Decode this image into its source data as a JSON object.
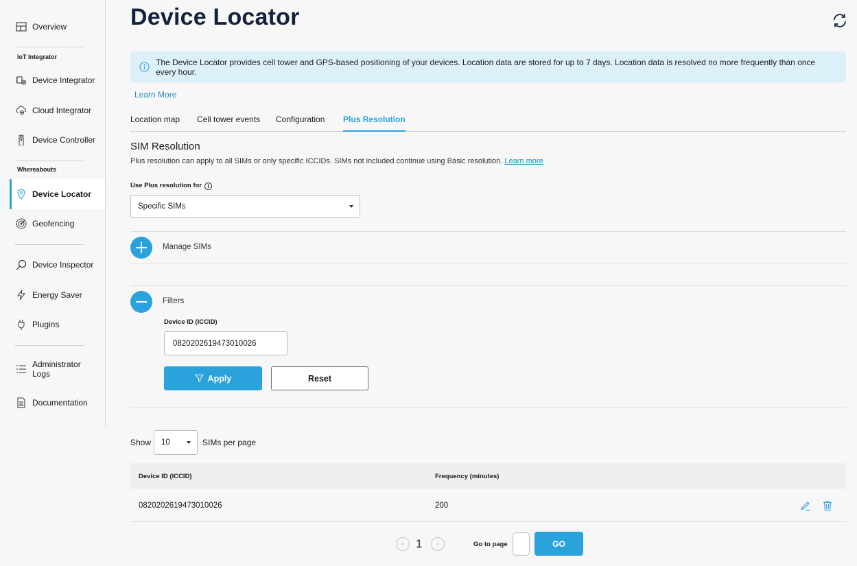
{
  "sidebar": {
    "overview": {
      "label": "Overview",
      "icon": "layout-icon"
    },
    "section_iot": "IoT Integrator",
    "device_integrator": {
      "label": "Device Integrator",
      "icon": "chip-gear-icon"
    },
    "cloud_integrator": {
      "label": "Cloud Integrator",
      "icon": "cloud-gear-icon"
    },
    "device_controller": {
      "label": "Device Controller",
      "icon": "remote-icon"
    },
    "section_whereabouts": "Whereabouts",
    "device_locator": {
      "label": "Device Locator",
      "icon": "location-pin-icon"
    },
    "geofencing": {
      "label": "Geofencing",
      "icon": "radar-icon"
    },
    "device_inspector": {
      "label": "Device Inspector",
      "icon": "magnifier-icon"
    },
    "energy_saver": {
      "label": "Energy Saver",
      "icon": "lightning-icon"
    },
    "plugins": {
      "label": "Plugins",
      "icon": "plug-icon"
    },
    "admin_logs": {
      "line1": "Administrator",
      "line2": "Logs",
      "icon": "list-icon"
    },
    "documentation": {
      "label": "Documentation",
      "icon": "document-icon"
    }
  },
  "header": {
    "title": "Device Locator",
    "refresh_icon": "refresh-icon"
  },
  "info_banner": {
    "text": "The Device Locator provides cell tower and GPS-based positioning of your devices. Location data are stored for up to 7 days. Location data is resolved no more frequently than once every hour.",
    "learn_more": "Learn More"
  },
  "tabs": [
    "Location map",
    "Cell tower events",
    "Configuration",
    "Plus Resolution"
  ],
  "active_tab": "Plus Resolution",
  "sim_resolution": {
    "title": "SIM Resolution",
    "description": "Plus resolution can apply to all SIMs or only specific ICCIDs. SIMs not included continue using Basic resolution.",
    "learn_more": "Learn more",
    "use_plus_label": "Use Plus resolution for",
    "use_plus_value": "Specific SIMs"
  },
  "manage_sims": {
    "label": "Manage SIMs"
  },
  "filters": {
    "label": "Filters",
    "device_id_label": "Device ID (ICCID)",
    "device_id_value": "0820202619473010026",
    "apply": "Apply",
    "reset": "Reset"
  },
  "pagination_top": {
    "show": "Show",
    "per_page_value": "10",
    "per_page_suffix": "SIMs per page"
  },
  "table": {
    "columns": [
      "Device ID (ICCID)",
      "Frequency (minutes)"
    ],
    "rows": [
      {
        "device_id": "0820202619473010026",
        "frequency": "200"
      }
    ]
  },
  "pagination_bottom": {
    "current_page": "1",
    "goto_label": "Go to page",
    "go": "GO"
  },
  "colors": {
    "accent": "#2aa3dc",
    "title": "#14213d",
    "info_bg": "#dcf0fa"
  }
}
